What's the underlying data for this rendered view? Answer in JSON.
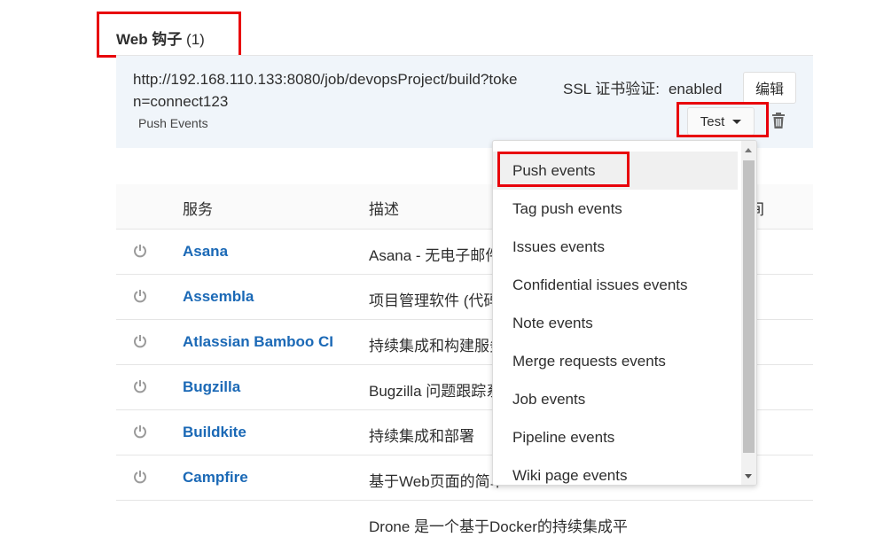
{
  "webhooks": {
    "title": "Web 钩子",
    "count": "(1)",
    "hook": {
      "url": "http://192.168.110.133:8080/job/devopsProject/build?token=connect123",
      "events": "Push Events",
      "ssl_label": "SSL 证书验证:",
      "ssl_value": "enabled",
      "edit_label": "编辑",
      "test_label": "Test"
    }
  },
  "services": {
    "headers": {
      "service": "服务",
      "description": "描述",
      "extra": "间"
    },
    "rows": [
      {
        "name": "Asana",
        "description": "Asana - 无电子邮件"
      },
      {
        "name": "Assembla",
        "description": "项目管理软件 (代码"
      },
      {
        "name": "Atlassian Bamboo CI",
        "description": "持续集成和构建服务"
      },
      {
        "name": "Bugzilla",
        "description": "Bugzilla 问题跟踪系"
      },
      {
        "name": "Buildkite",
        "description": "持续集成和部署"
      },
      {
        "name": "Campfire",
        "description": "基于Web页面的简单"
      },
      {
        "name": "",
        "description": "Drone 是一个基于Docker的持续集成平"
      }
    ]
  },
  "test_menu": {
    "items": [
      "Push events",
      "Tag push events",
      "Issues events",
      "Confidential issues events",
      "Note events",
      "Merge requests events",
      "Job events",
      "Pipeline events",
      "Wiki page events"
    ],
    "selected": "Push events"
  },
  "colors": {
    "highlight": "#e8000b",
    "link": "#1b69b6",
    "panel": "#f0f5fa"
  }
}
